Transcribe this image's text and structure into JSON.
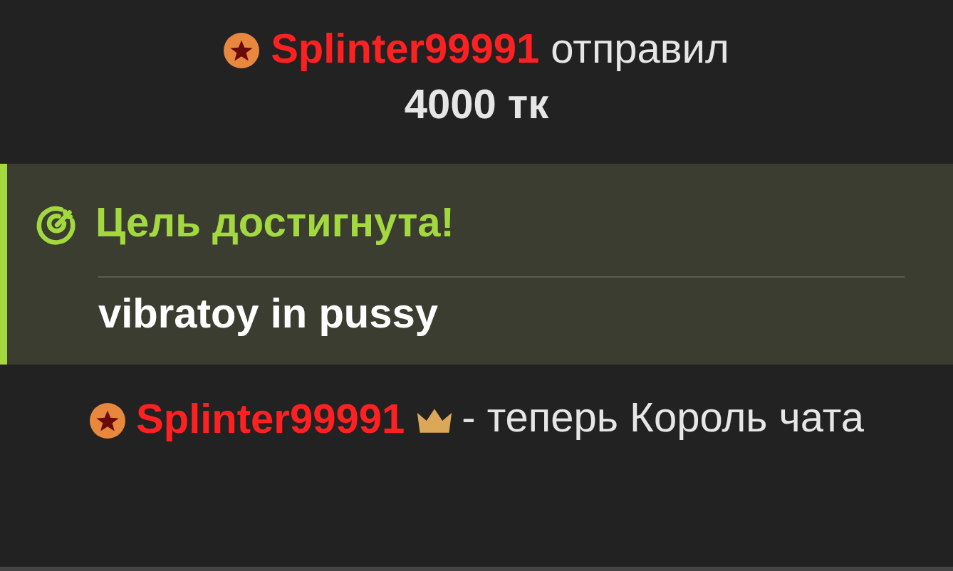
{
  "messages": [
    {
      "kind": "tip",
      "user": "Splinter99991",
      "action": "отправил",
      "amount": "4000 тк"
    },
    {
      "kind": "goal",
      "title": "Цель достигнута!",
      "text": "vibratoy in pussy"
    },
    {
      "kind": "king",
      "user": "Splinter99991",
      "text": "- теперь Король чата"
    }
  ]
}
